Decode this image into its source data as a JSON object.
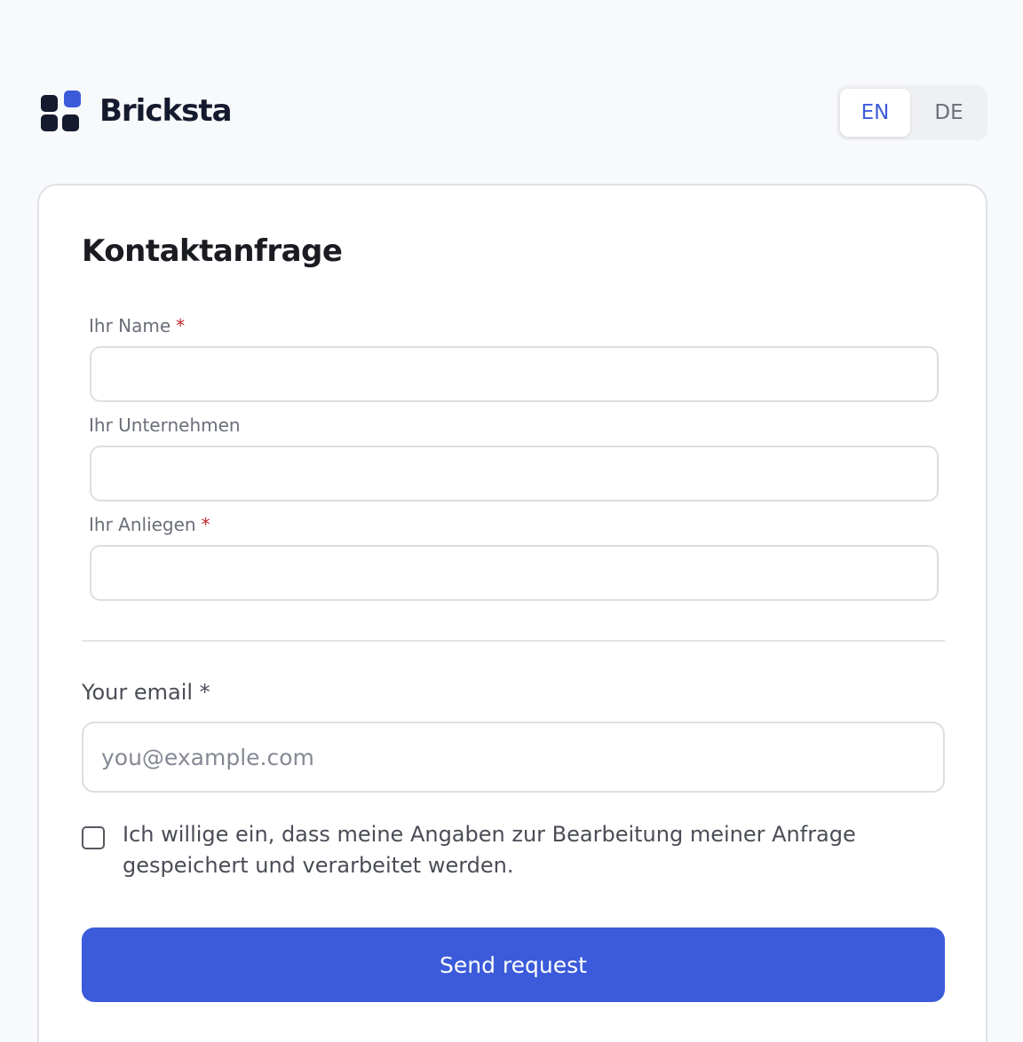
{
  "brand": {
    "name": "Bricksta",
    "icon": "grid-squares-logo-icon",
    "accent_color": "#3b5bdb",
    "dark_color": "#161a2e"
  },
  "language_switch": {
    "options": [
      {
        "label": "EN",
        "active": true
      },
      {
        "label": "DE",
        "active": false
      }
    ]
  },
  "form": {
    "title": "Kontaktanfrage",
    "fields": [
      {
        "label": "Ihr Name",
        "required_marker": "*",
        "value": ""
      },
      {
        "label": "Ihr Unternehmen",
        "required_marker": "",
        "value": ""
      },
      {
        "label": "Ihr Anliegen",
        "required_marker": "*",
        "value": ""
      }
    ],
    "email": {
      "label": "Your email *",
      "placeholder": "you@example.com",
      "value": ""
    },
    "consent": {
      "text": "Ich willige ein, dass meine Angaben zur Bearbeitung meiner Anfrage gespeichert und verarbeitet werden.",
      "checked": false
    },
    "submit_label": "Send request",
    "required_color": "#c0262d"
  }
}
